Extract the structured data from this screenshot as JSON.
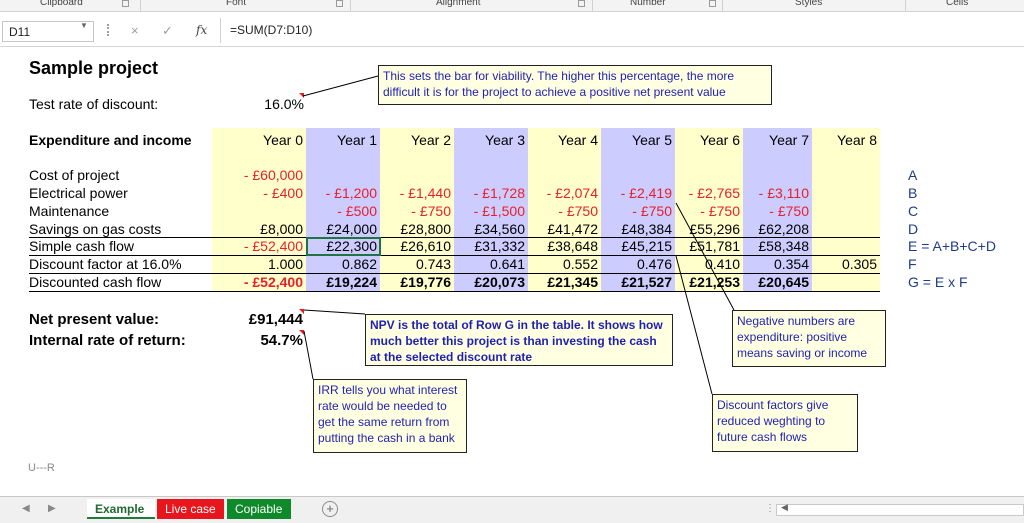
{
  "ribbon": {
    "groups": [
      "Clipboard",
      "Font",
      "Alignment",
      "Number",
      "Styles",
      "Cells"
    ]
  },
  "formula_bar": {
    "name_box": "D11",
    "fx_label": "fx",
    "cancel_icon": "×",
    "enter_icon": "✓",
    "formula": "=SUM(D7:D10)"
  },
  "sheet": {
    "title": "Sample project",
    "test_rate_label": "Test rate of discount:",
    "test_rate_value": "16.0%",
    "table_header_label": "Expenditure and income",
    "years": [
      "Year 0",
      "Year 1",
      "Year 2",
      "Year 3",
      "Year 4",
      "Year 5",
      "Year 6",
      "Year 7",
      "Year 8"
    ],
    "rows": [
      {
        "label": "Cost of project",
        "values": [
          "- £60,000",
          "",
          "",
          "",
          "",
          "",
          "",
          "",
          ""
        ],
        "letter": "A"
      },
      {
        "label": "Electrical power",
        "values": [
          "- £400",
          "- £1,200",
          "- £1,440",
          "- £1,728",
          "- £2,074",
          "- £2,419",
          "- £2,765",
          "- £3,110",
          ""
        ],
        "letter": "B"
      },
      {
        "label": "Maintenance",
        "values": [
          "",
          "- £500",
          "- £750",
          "- £1,500",
          "- £750",
          "- £750",
          "- £750",
          "- £750",
          ""
        ],
        "letter": "C"
      },
      {
        "label": "Savings on gas costs",
        "values": [
          "£8,000",
          "£24,000",
          "£28,800",
          "£34,560",
          "£41,472",
          "£48,384",
          "£55,296",
          "£62,208",
          ""
        ],
        "letter": "D"
      },
      {
        "label": "Simple cash flow",
        "values": [
          "- £52,400",
          "£22,300",
          "£26,610",
          "£31,332",
          "£38,648",
          "£45,215",
          "£51,781",
          "£58,348",
          ""
        ],
        "letter": "E = A+B+C+D"
      },
      {
        "label": "Discount factor at 16.0%",
        "values": [
          "1.000",
          "0.862",
          "0.743",
          "0.641",
          "0.552",
          "0.476",
          "0.410",
          "0.354",
          "0.305"
        ],
        "letter": "F"
      },
      {
        "label": "Discounted cash flow",
        "values": [
          "- £52,400",
          "£19,224",
          "£19,776",
          "£20,073",
          "£21,345",
          "£21,527",
          "£21,253",
          "£20,645",
          ""
        ],
        "letter": "G = E x F"
      }
    ],
    "npv_label": "Net present value:",
    "npv_value": "£91,444",
    "irr_label": "Internal rate of return:",
    "irr_value": "54.7%",
    "signature": "U---R"
  },
  "notes": {
    "rate": "This sets the bar for viability. The higher this percentage, the more difficult it is for the project to achieve a positive net present value",
    "npv": "NPV is the total of Row G in the table. It shows how much better this project is than investing the cash at the selected discount rate",
    "irr": "IRR tells you what interest rate would be needed to get the same return from putting the cash in a bank",
    "negative": "Negative numbers are expenditure: positive means saving or income",
    "discount": "Discount factors give reduced weghting to future cash flows"
  },
  "tabs": {
    "items": [
      "Example",
      "Live case",
      "Copiable"
    ],
    "active": "Example",
    "colors": {
      "live": "#e8161c",
      "copiable": "#0f8a2a"
    }
  }
}
